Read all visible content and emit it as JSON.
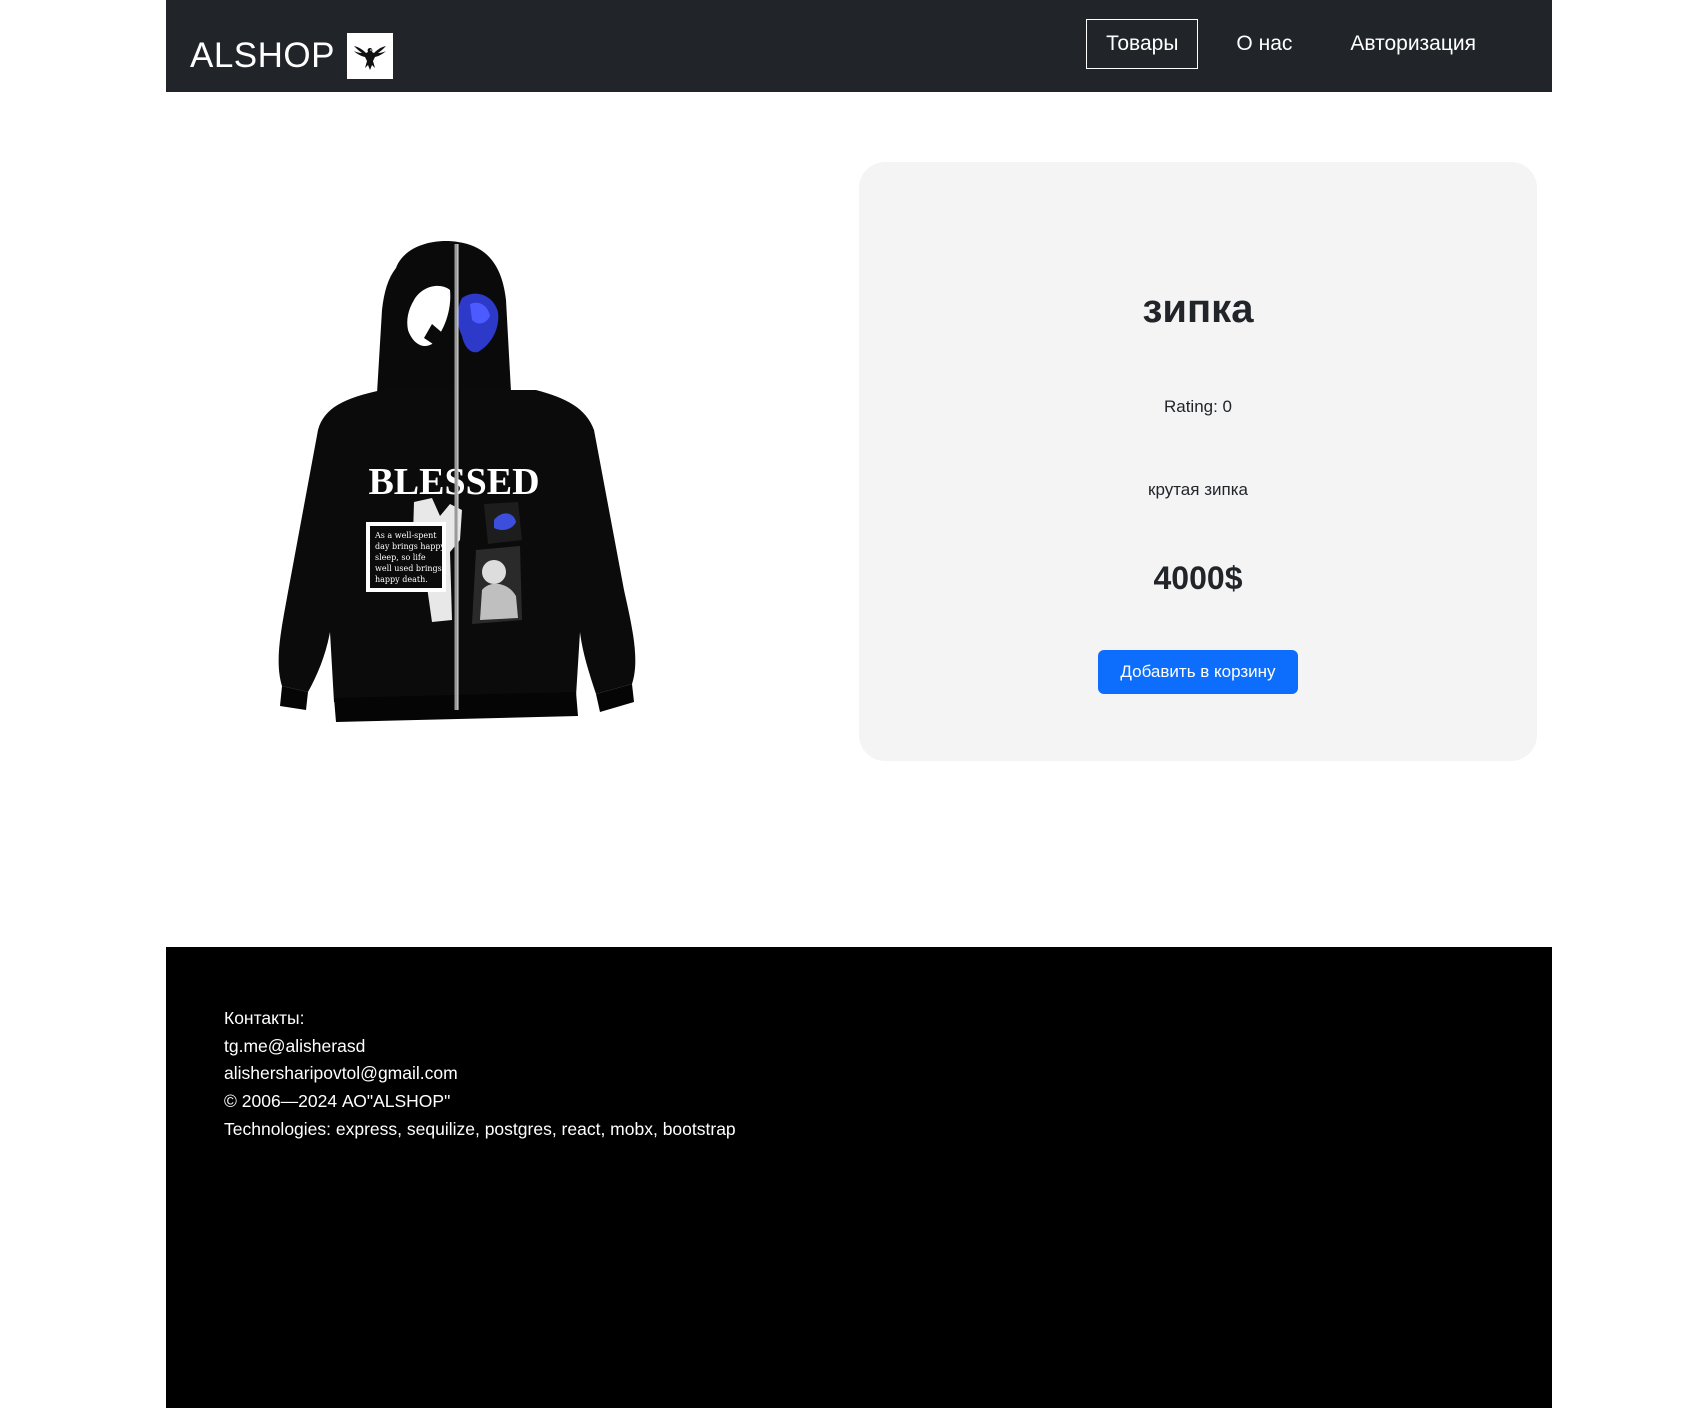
{
  "navbar": {
    "brand": "ALSHOP",
    "logo_icon": "eagle-icon",
    "links": [
      {
        "label": "Товары",
        "active": true
      },
      {
        "label": "О нас",
        "active": false
      },
      {
        "label": "Авторизация",
        "active": false
      }
    ]
  },
  "product": {
    "image_icon": "hoodie-image",
    "title": "зипка",
    "rating": "Rating: 0",
    "description": "крутая зипка",
    "price": "4000$",
    "add_to_cart_label": "Добавить в корзину",
    "print_text": "BLESSED",
    "print_caption": [
      "As a well-spent",
      "day brings happy",
      "sleep, so life",
      "well used brings",
      "happy death."
    ]
  },
  "footer": {
    "contacts_label": "Контакты:",
    "telegram": "tg.me@alisherasd",
    "email": "alishersharipovtol@gmail.com",
    "copyright": "© 2006—2024 АО\"ALSHOP\"",
    "technologies": "Technologies: express, sequilize, postgres, react, mobx, bootstrap"
  },
  "colors": {
    "navbar_bg": "#212529",
    "card_bg": "#f4f4f4",
    "accent": "#0d6efd",
    "footer_bg": "#000000"
  }
}
